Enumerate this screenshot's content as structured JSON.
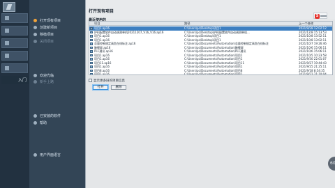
{
  "left_strip": {
    "bottom_item_label": "入门"
  },
  "nav": {
    "items": [
      {
        "label": "打开现有项目",
        "state": "active"
      },
      {
        "label": "创建新项目",
        "state": "normal"
      },
      {
        "label": "移植项目",
        "state": "normal"
      },
      {
        "label": "关闭项目",
        "state": "disabled"
      },
      {
        "label": "欢迎光临",
        "state": "normal"
      },
      {
        "label": "新手上路",
        "state": "disabled"
      },
      {
        "label": "已安装的软件",
        "state": "normal"
      },
      {
        "label": "帮助",
        "state": "normal"
      },
      {
        "label": "用户界面语言",
        "state": "normal"
      }
    ]
  },
  "main": {
    "title": "打开现有项目",
    "section_label": "最近使用的",
    "columns": [
      "项目",
      "路径",
      "上一个修改"
    ],
    "rows": [
      {
        "name": "项目1.ap16",
        "path": "C:\\Users\\pc\\Desktop\\项目1",
        "date": "2021/9/28 12:02:12",
        "selected": true
      },
      {
        "name": "护料配置软件自动调测单机20211207_V16_V16.ap16",
        "path": "C:\\Users\\pc\\Desktop\\护料配置软件自动调测单机...",
        "date": "2021/12/8 15:13:53",
        "selected": false
      },
      {
        "name": "项目1.ap16",
        "path": "C:\\Users\\pc\\Desktop\\项目1",
        "date": "2021/10/8 13:52:11",
        "selected": false
      },
      {
        "name": "项目1.ap16",
        "path": "C:\\Users\\pc\\Desktop\\项目1",
        "date": "2021/10/8 13:02:11",
        "selected": false
      },
      {
        "name": "总量控制规定高危在线标注.ap16",
        "path": "C:\\Users\\pc\\Documents\\Automation\\总量控制规定高危在线标注",
        "date": "2021/10/7 19:26:46",
        "selected": false
      },
      {
        "name": "触摸屏.ap16",
        "path": "C:\\Users\\pc\\Documents\\Automation\\触摸屏",
        "date": "2021/10/6 15:06:11",
        "selected": false
      },
      {
        "name": "PLC通讯.ap16",
        "path": "C:\\Users\\pc\\Documents\\Automation\\PLC通讯",
        "date": "2021/10/6 15:06:11",
        "selected": false
      },
      {
        "name": "项目1.ap16",
        "path": "C:\\Users\\pc\\Documents\\Automation\\项目1",
        "date": "2021/10/5 10:23:58",
        "selected": false
      },
      {
        "name": "项目1.ap16",
        "path": "C:\\Users\\pc\\Documents\\Automation\\项目1",
        "date": "2021/9/30 22:01:07",
        "selected": false
      },
      {
        "name": "项目11.ap16",
        "path": "C:\\Users\\pc\\Documents\\Automation\\项目11",
        "date": "2021/9/27 19:44:43",
        "selected": false
      },
      {
        "name": "项目1.ap16",
        "path": "C:\\Users\\pc\\Documents\\Automation\\项目1",
        "date": "2021/9/25 21:25:11",
        "selected": false
      },
      {
        "name": "项目8.ap16",
        "path": "C:\\Users\\pc\\Documents\\Automation\\项目8",
        "date": "2021/9/18 8:54:35",
        "selected": false
      },
      {
        "name": "项目1.ap16",
        "path": "C:\\Users\\pc\\Documents\\Automation\\项目1",
        "date": "2021/9/22 21:10:04",
        "selected": false
      },
      {
        "name": "项目1.ap16",
        "path": "C:\\Users\\pc\\Documents\\Automation\\项目1",
        "date": "2021/9/16 21:35:39",
        "selected": false
      }
    ],
    "checkbox_label": "显示更多旧的项目信息",
    "open_button": "打开",
    "remove_button": "删除"
  },
  "corner_badge": "60",
  "colors": {
    "accent_orange": "#f2a33a",
    "selection_blue": "#3d7fc1",
    "brand_red": "#e4312b"
  }
}
